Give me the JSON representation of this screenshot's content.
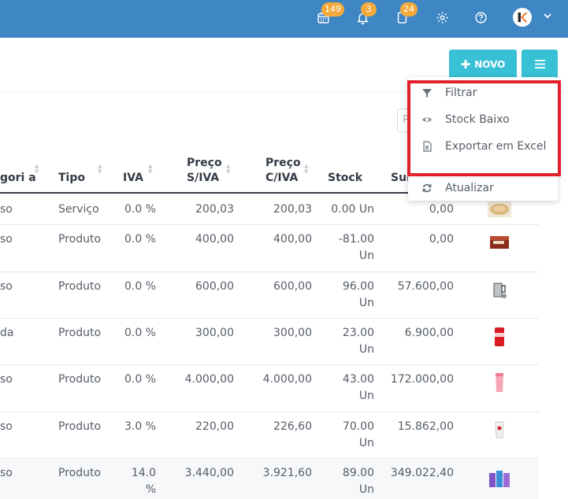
{
  "topbar": {
    "badges": {
      "tasks": "149",
      "notifications": "3",
      "documents": "24"
    },
    "avatar_letter": "k"
  },
  "toolbar": {
    "new_label": "NOVO"
  },
  "search": {
    "placeholder_fragment": "P"
  },
  "dropdown": {
    "items": [
      {
        "label": "Filtrar",
        "icon": "filter-icon"
      },
      {
        "label": "Stock Baixo",
        "icon": "eye-icon"
      },
      {
        "label": "Exportar em Excel",
        "icon": "excel-file-icon"
      },
      {
        "label": "Atualizar",
        "icon": "refresh-icon"
      }
    ]
  },
  "table": {
    "headers": {
      "categoria": "gori a",
      "tipo": "Tipo",
      "iva": "IVA",
      "preco_siva_1": "Preço",
      "preco_siva_2": "S/IVA",
      "preco_civa_1": "Preço",
      "preco_civa_2": "C/IVA",
      "stock": "Stock",
      "subtotal": "Sub"
    },
    "rows": [
      {
        "categoria": "so",
        "tipo": "Serviço",
        "iva": "0.0 %",
        "preco_siva": "200,03",
        "preco_civa": "200,03",
        "stock": "0.00 Un",
        "subtotal": "0,00",
        "image": "bread-icon"
      },
      {
        "categoria": "so",
        "tipo": "Produto",
        "iva": "0.0 %",
        "preco_siva": "400,00",
        "preco_civa": "400,00",
        "stock_1": "-81.00",
        "stock_2": "Un",
        "subtotal": "0,00",
        "image": "box-icon"
      },
      {
        "categoria": "so",
        "tipo": "Produto",
        "iva": "0.0 %",
        "preco_siva": "600,00",
        "preco_civa": "600,00",
        "stock_1": "96.00",
        "stock_2": "Un",
        "subtotal": "57.600,00",
        "image": "kettle-icon"
      },
      {
        "categoria": "da",
        "tipo": "Produto",
        "iva": "0.0 %",
        "preco_siva": "300,00",
        "preco_civa": "300,00",
        "stock_1": "23.00",
        "stock_2": "Un",
        "subtotal": "6.900,00",
        "image": "soda-can-icon"
      },
      {
        "categoria": "so",
        "tipo": "Produto",
        "iva": "0.0 %",
        "preco_siva": "4.000,00",
        "preco_civa": "4.000,00",
        "stock_1": "43.00",
        "stock_2": "Un",
        "subtotal": "172.000,00",
        "image": "pink-cup-icon"
      },
      {
        "categoria": "so",
        "tipo": "Produto",
        "iva": "3.0 %",
        "preco_siva": "220,00",
        "preco_civa": "226,60",
        "stock_1": "70.00",
        "stock_2": "Un",
        "subtotal": "15.862,00",
        "image": "cup-icon"
      },
      {
        "categoria": "so",
        "tipo": "Produto",
        "iva_1": "14.0",
        "iva_2": "%",
        "preco_siva": "3.440,00",
        "preco_civa": "3.921,60",
        "stock_1": "89.00",
        "stock_2": "Un",
        "subtotal": "349.022,40",
        "image": "tumblers-icon"
      }
    ]
  },
  "colors": {
    "topbar": "#3f86c4",
    "accent": "#38c1d6",
    "badge": "#f4a93b",
    "highlight": "#e0202b"
  }
}
